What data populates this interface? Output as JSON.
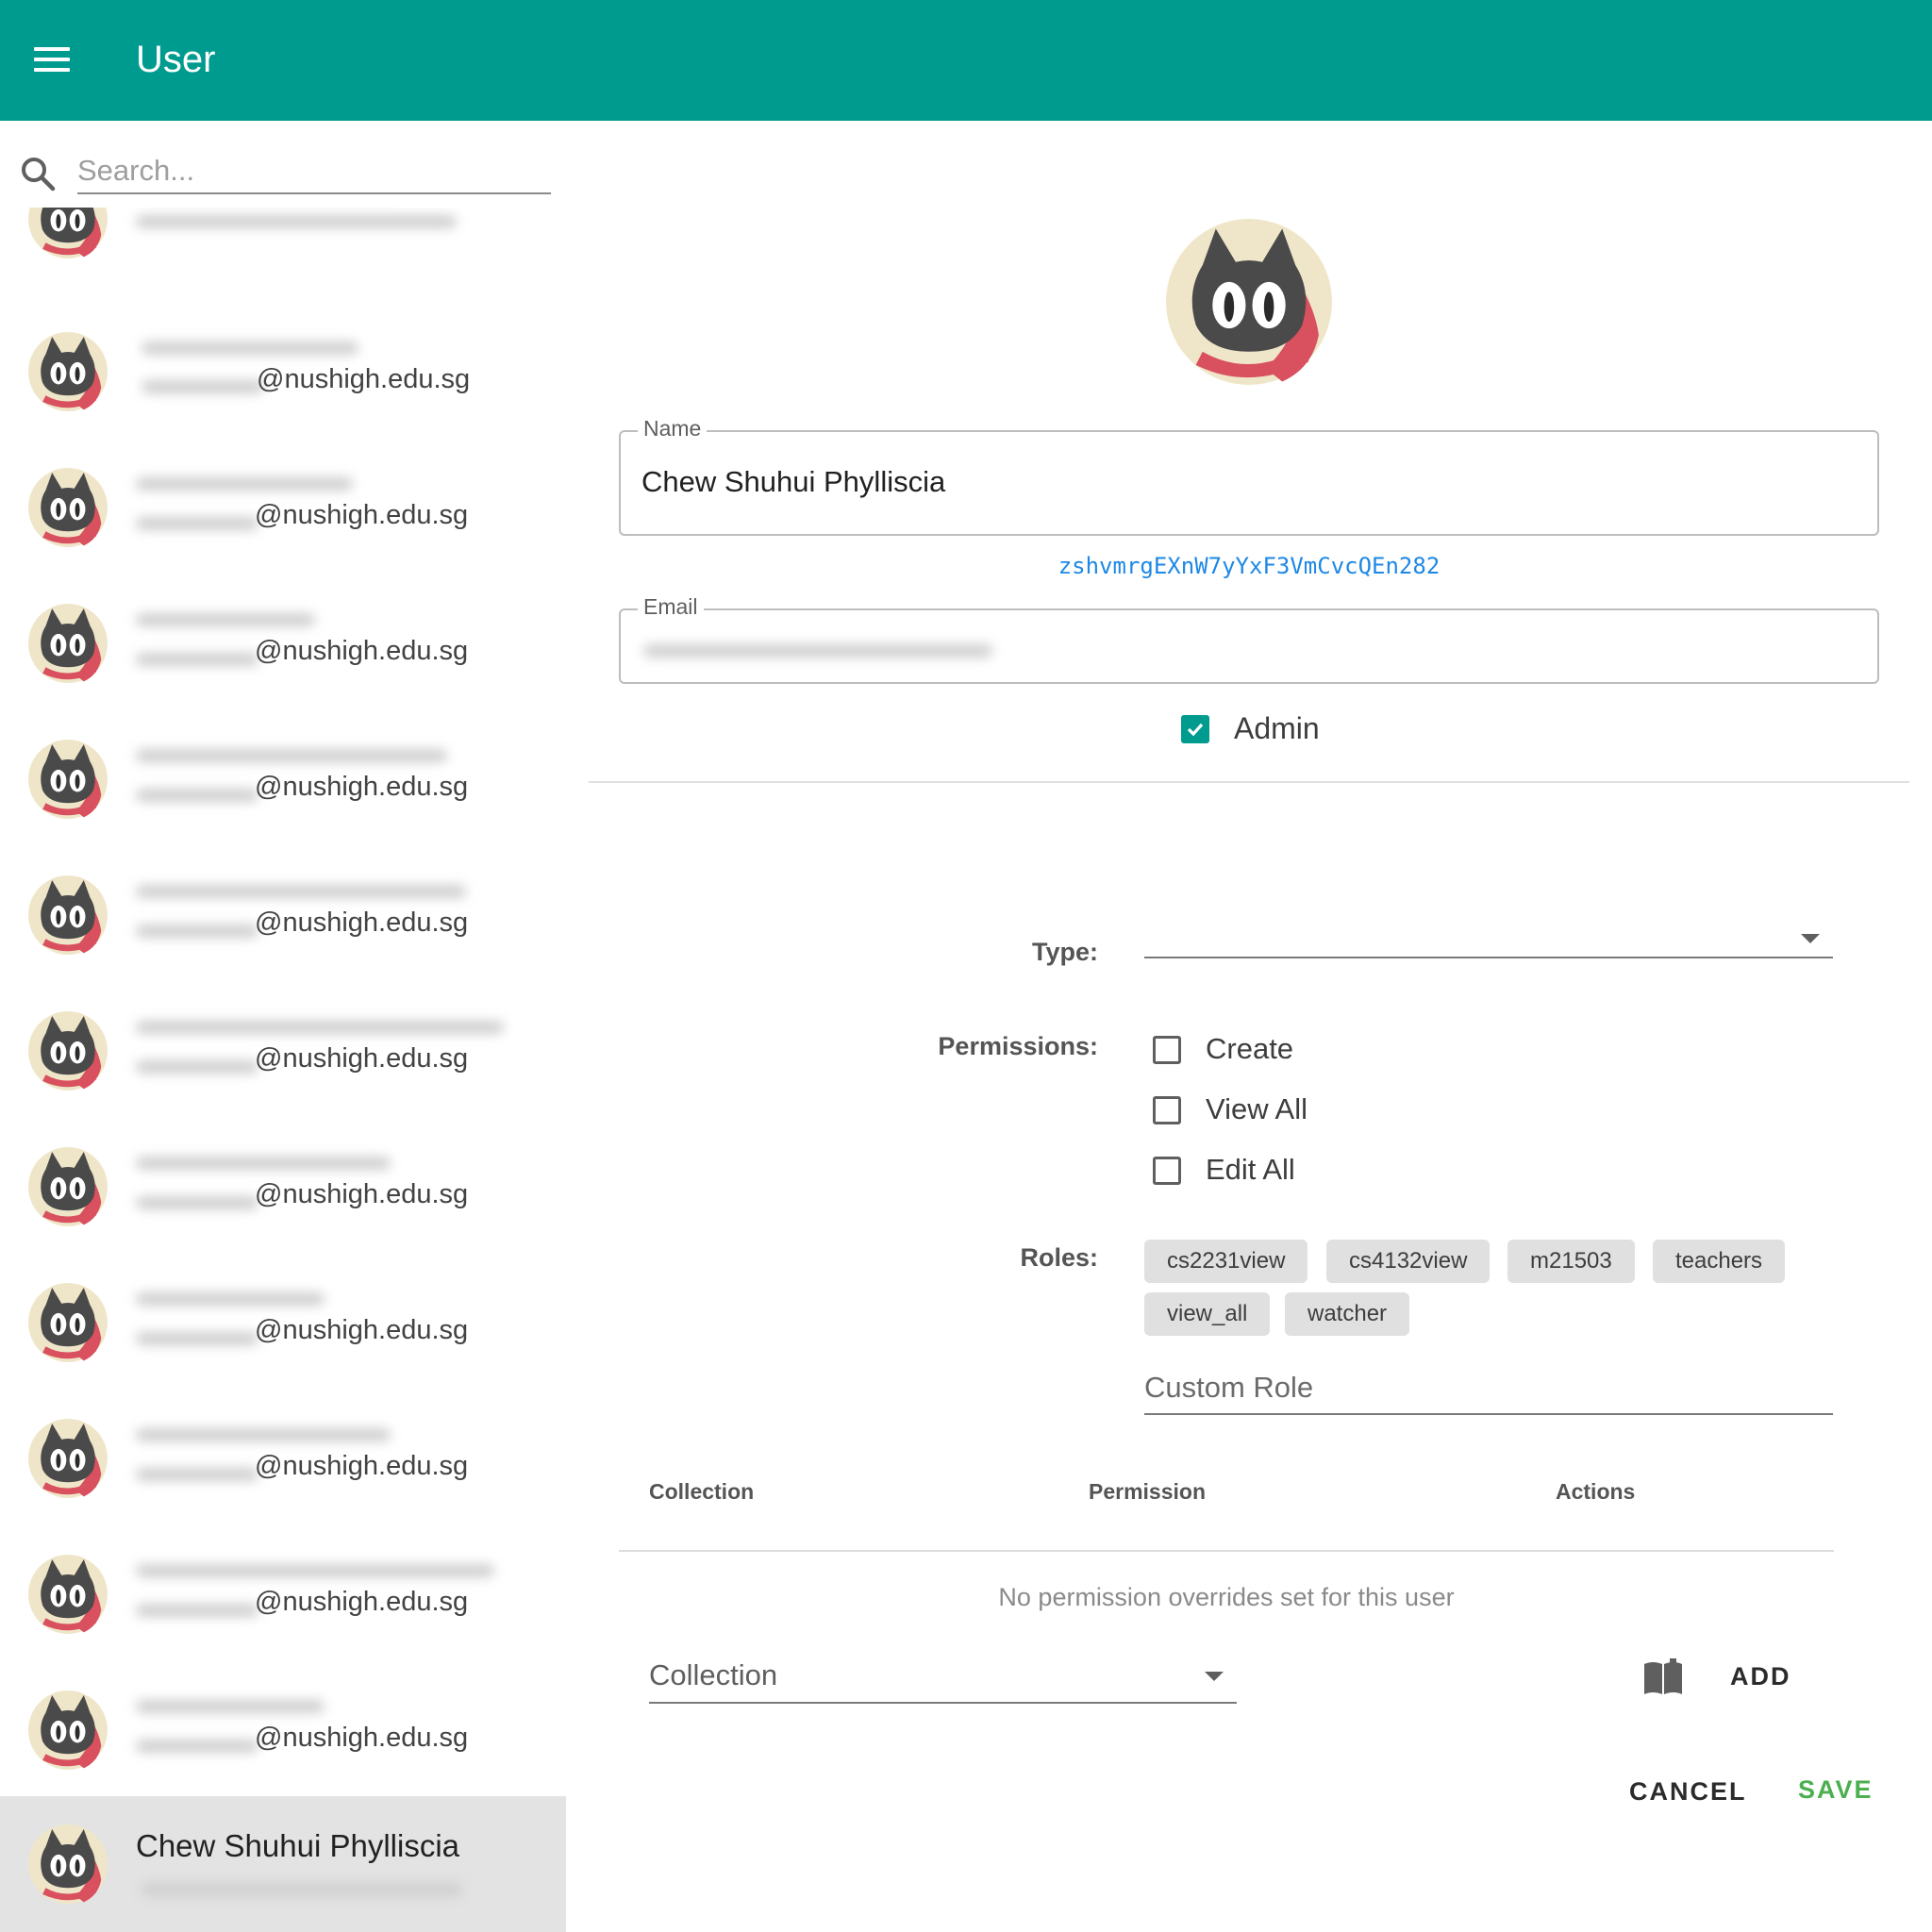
{
  "appbar": {
    "title": "User",
    "menu_icon": "menu-icon",
    "theme_icon": "dark-mode-moon-icon",
    "color": "#009b8f"
  },
  "sidebar": {
    "search_placeholder": "Search...",
    "users": [
      {
        "email": "",
        "avatar": "cat-avatar-icon"
      },
      {
        "email": "@nushigh.edu.sg",
        "avatar": "cat-avatar-icon"
      },
      {
        "email": "@nushigh.edu.sg",
        "avatar": "cat-avatar-icon"
      },
      {
        "email": "@nushigh.edu.sg",
        "avatar": "cat-avatar-icon"
      },
      {
        "email": "@nushigh.edu.sg",
        "avatar": "cat-avatar-icon"
      },
      {
        "email": "@nushigh.edu.sg",
        "avatar": "cat-avatar-icon"
      },
      {
        "email": "@nushigh.edu.sg",
        "avatar": "cat-avatar-icon"
      },
      {
        "email": "@nushigh.edu.sg",
        "avatar": "cat-avatar-icon"
      },
      {
        "email": "@nushigh.edu.sg",
        "avatar": "cat-avatar-icon"
      },
      {
        "email": "@nushigh.edu.sg",
        "avatar": "cat-avatar-icon"
      },
      {
        "email": "@nushigh.edu.sg",
        "avatar": "cat-avatar-icon"
      },
      {
        "email": "@nushigh.edu.sg",
        "avatar": "cat-avatar-icon"
      }
    ],
    "selected_user": {
      "name": "Chew Shuhui Phylliscia",
      "avatar": "cat-avatar-icon"
    }
  },
  "form": {
    "name_label": "Name",
    "name_value": "Chew Shuhui Phylliscia",
    "uid": "zshvmrgEXnW7yYxF3VmCvcQEn282",
    "email_label": "Email",
    "admin_label": "Admin",
    "admin_checked": true,
    "type_label": "Type:",
    "type_value": "",
    "permissions_label": "Permissions:",
    "permissions": [
      {
        "label": "Create",
        "checked": false
      },
      {
        "label": "View All",
        "checked": false
      },
      {
        "label": "Edit All",
        "checked": false
      }
    ],
    "roles_label": "Roles:",
    "roles": [
      "cs2231view",
      "cs4132view",
      "m21503",
      "teachers",
      "view_all",
      "watcher"
    ],
    "custom_role_placeholder": "Custom Role"
  },
  "overrides": {
    "columns": [
      "Collection",
      "Permission",
      "Actions"
    ],
    "empty_message": "No permission overrides set for this user",
    "collection_placeholder": "Collection",
    "add_label": "ADD",
    "book_icon": "book-icon"
  },
  "actions": {
    "cancel_label": "CANCEL",
    "save_label": "SAVE",
    "save_color": "#4caf50"
  }
}
